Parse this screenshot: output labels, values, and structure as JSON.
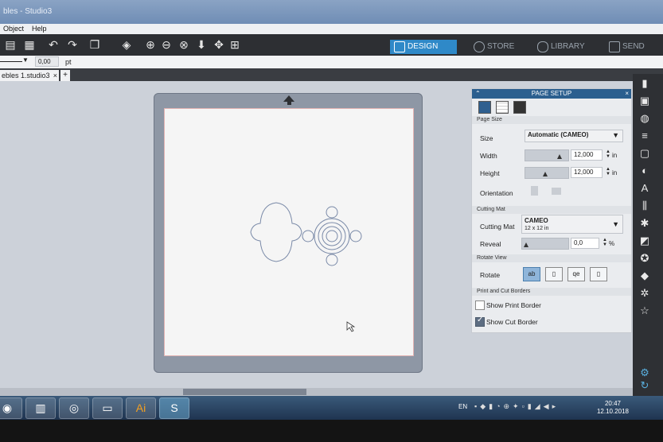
{
  "window": {
    "title": "bles - Studio3"
  },
  "menu": {
    "object": "Object",
    "help": "Help"
  },
  "toolbar": {
    "icons": [
      "save-icon",
      "undo-icon",
      "redo-icon",
      "group-icon",
      "ungroup-icon",
      "zoom-in-icon",
      "zoom-out-icon",
      "zoom-fit-icon",
      "move-down-icon",
      "move-icon",
      "add-page-icon"
    ],
    "tabs": {
      "design": "DESIGN",
      "store": "STORE",
      "library": "LIBRARY",
      "send": "SEND"
    }
  },
  "linebar": {
    "value": "0,00",
    "unit": "pt"
  },
  "doc_tab": {
    "name": "ebles 1.studio3",
    "close": "×",
    "add": "+"
  },
  "panel": {
    "title": "PAGE SETUP",
    "close": "×",
    "section_page_size": "Page Size",
    "size_label": "Size",
    "size_value": "Automatic (CAMEO)",
    "width_label": "Width",
    "width_value": "12,000",
    "height_label": "Height",
    "height_value": "12,000",
    "unit_in": "in",
    "orientation_label": "Orientation",
    "section_cutting_mat": "Cutting Mat",
    "cutting_mat_label": "Cutting Mat",
    "cutting_mat_value": "CAMEO",
    "cutting_mat_sub": "12 x 12 in",
    "reveal_label": "Reveal",
    "reveal_value": "0,0",
    "reveal_unit": "%",
    "section_rotate": "Rotate View",
    "rotate_label": "Rotate",
    "section_borders": "Print and Cut Borders",
    "show_print_border": "Show Print Border",
    "show_cut_border": "Show Cut Border",
    "print_border_checked": false,
    "cut_border_checked": true
  },
  "taskbar": {
    "lang": "EN",
    "time": "20:47",
    "date": "12.10.2018"
  }
}
